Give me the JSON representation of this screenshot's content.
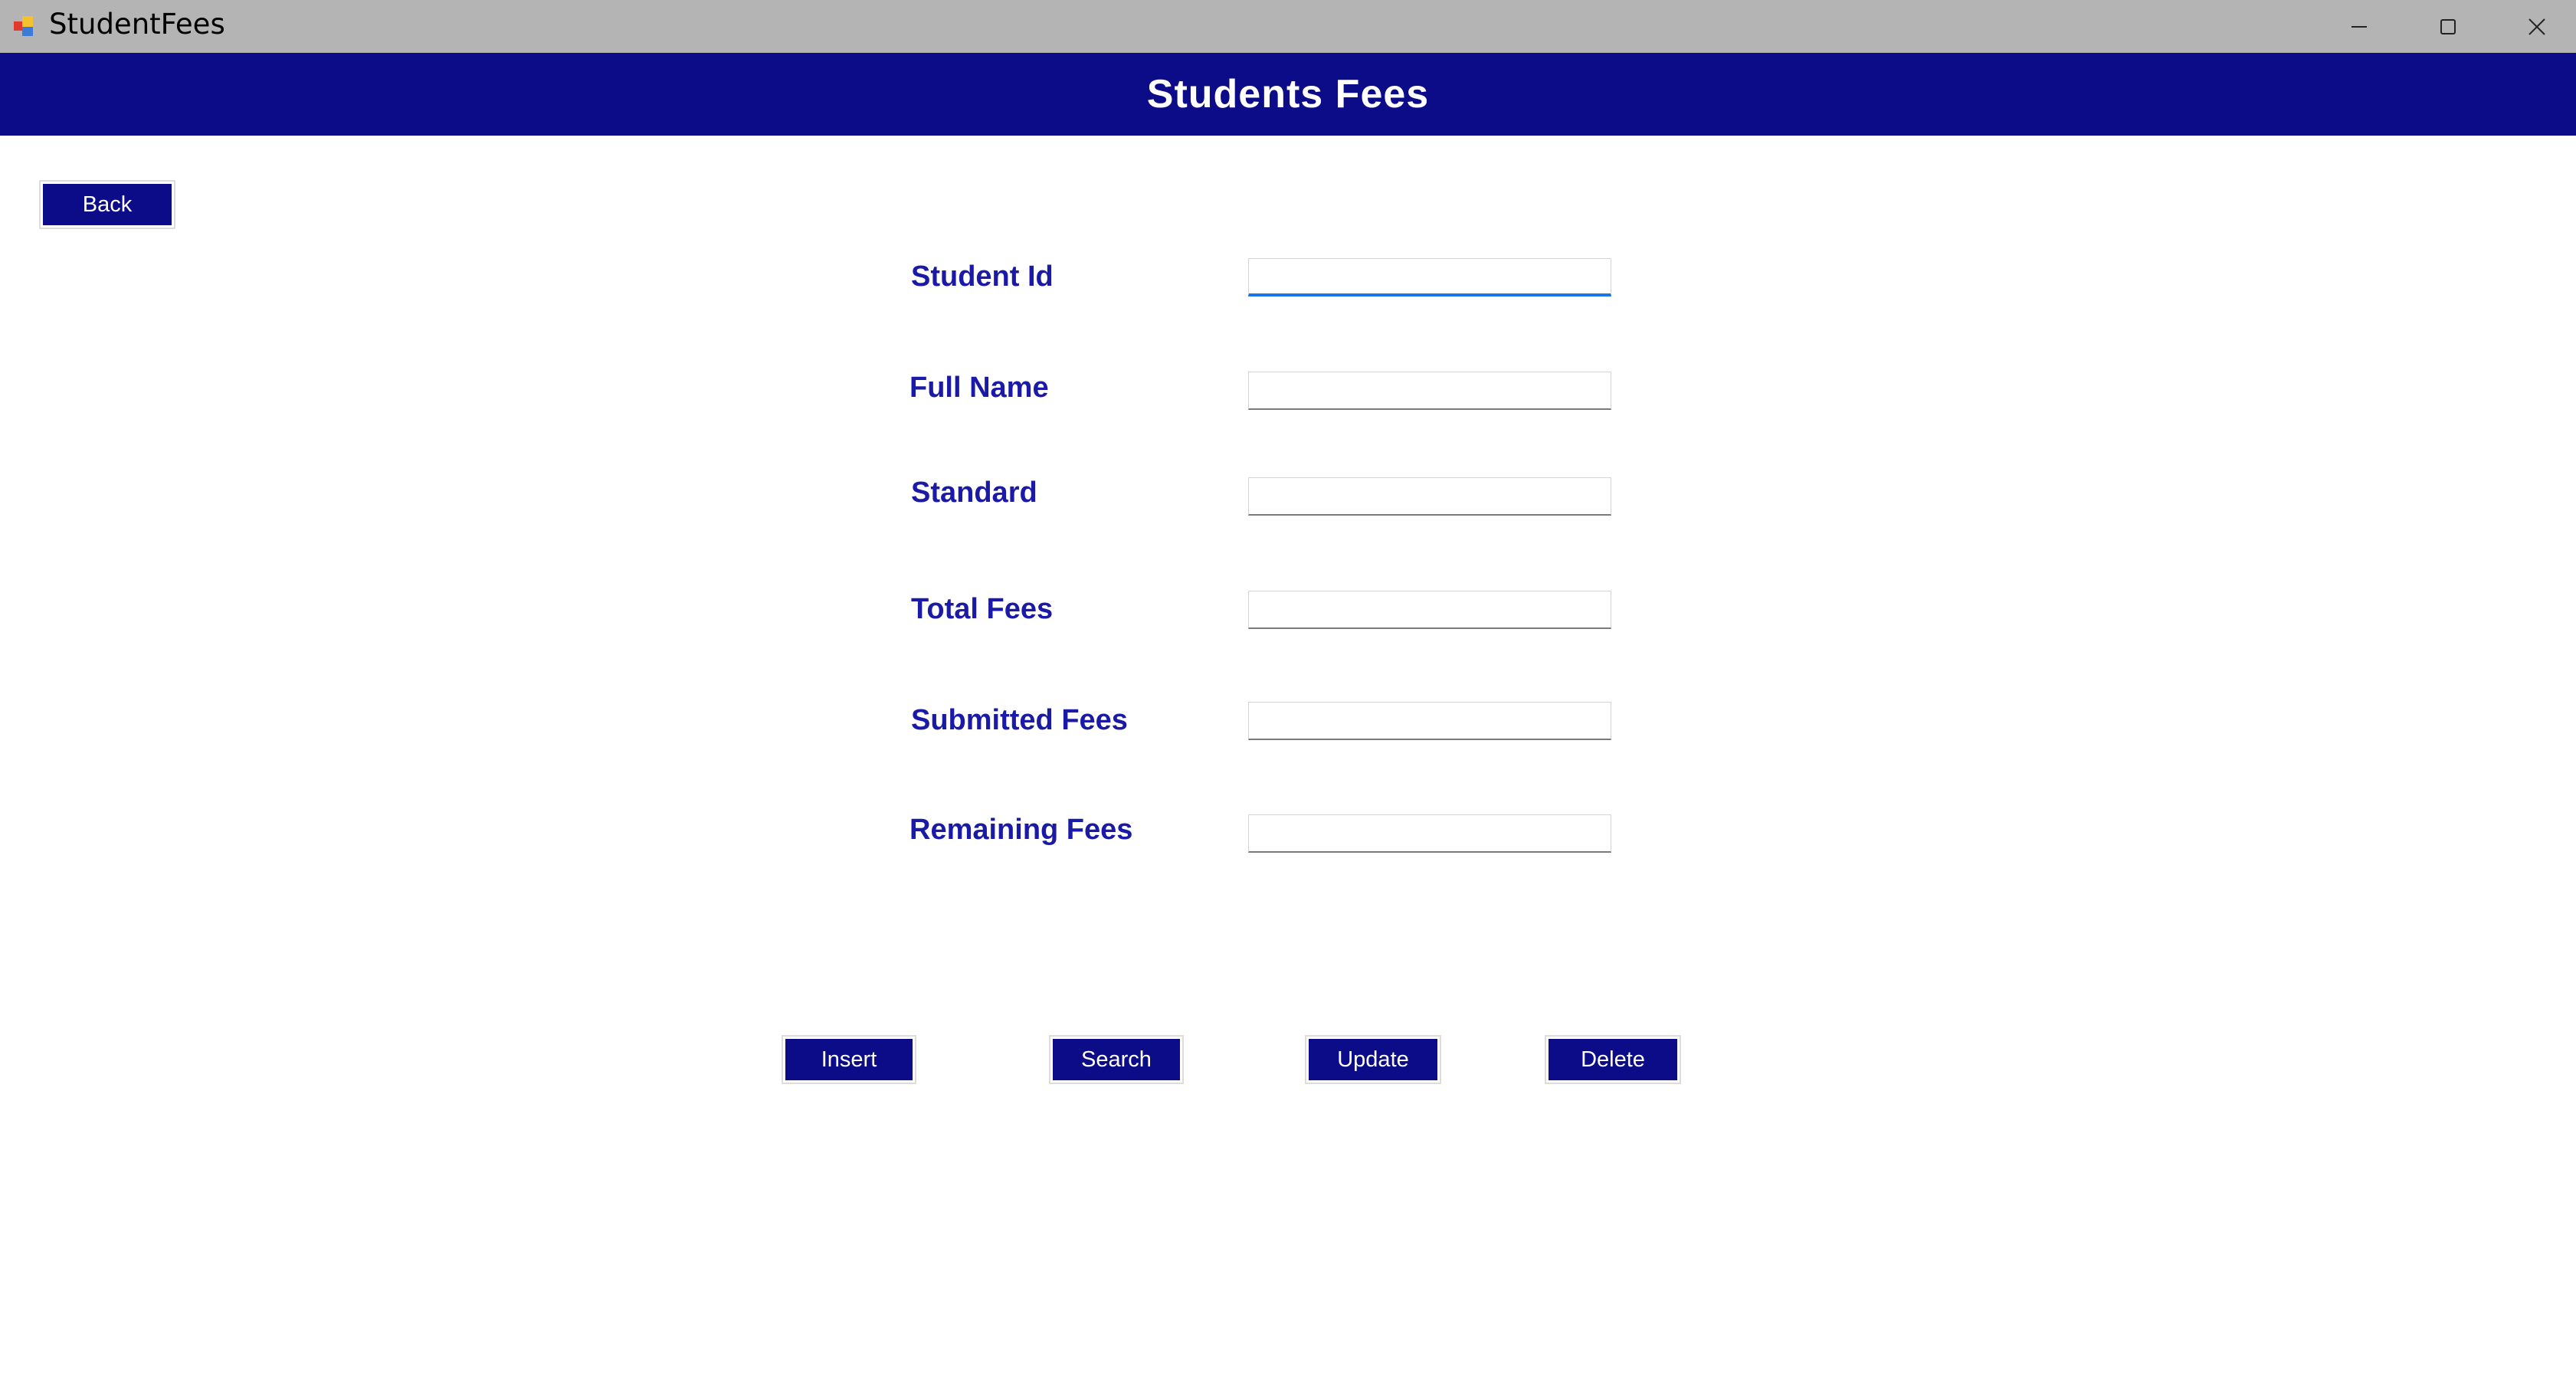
{
  "window": {
    "title": "StudentFees",
    "icons": {
      "app": "app-icon",
      "minimize": "minimize-icon",
      "maximize": "maximize-icon",
      "close": "close-icon"
    }
  },
  "header": {
    "title": "Students Fees"
  },
  "back_button": {
    "label": "Back"
  },
  "form": {
    "fields": [
      {
        "label": "Student Id",
        "value": "",
        "focused": true
      },
      {
        "label": "Full Name",
        "value": ""
      },
      {
        "label": "Standard",
        "value": ""
      },
      {
        "label": "Total Fees",
        "value": ""
      },
      {
        "label": "Submitted Fees",
        "value": ""
      },
      {
        "label": "Remaining Fees",
        "value": ""
      }
    ]
  },
  "actions": {
    "insert": "Insert",
    "search": "Search",
    "update": "Update",
    "delete": "Delete"
  },
  "colors": {
    "banner": "#0c0c88",
    "label": "#1a1aa6",
    "titlebar": "#b4b4b4",
    "focus": "#1a73e8"
  }
}
